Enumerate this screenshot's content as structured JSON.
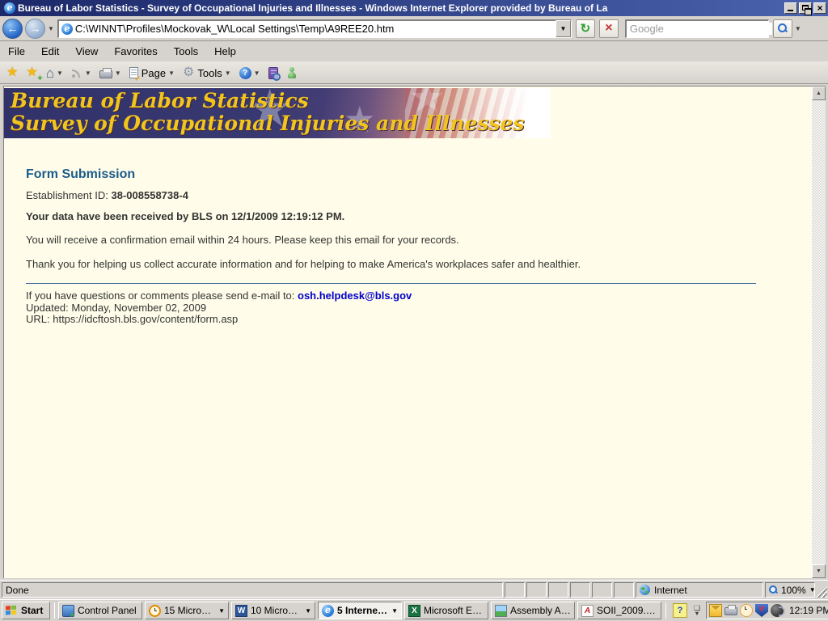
{
  "window": {
    "title": "Bureau of Labor Statistics - Survey of Occupational Injuries and Illnesses - Windows Internet Explorer provided by Bureau of La"
  },
  "address_bar": {
    "url": "C:\\WINNT\\Profiles\\Mockovak_W\\Local Settings\\Temp\\A9REE20.htm",
    "search_placeholder": "Google"
  },
  "menu_bar": {
    "items": [
      "File",
      "Edit",
      "View",
      "Favorites",
      "Tools",
      "Help"
    ]
  },
  "toolbar": {
    "page_label": "Page",
    "tools_label": "Tools"
  },
  "banner": {
    "line1": "Bureau of Labor Statistics",
    "line2": "Survey of Occupational Injuries and Illnesses"
  },
  "content": {
    "heading": "Form Submission",
    "establishment_label": "Establishment ID: ",
    "establishment_id": "38-008558738-4",
    "received_line": "Your data have been received by BLS on 12/1/2009 12:19:12 PM.",
    "para1": "You will receive a confirmation email within 24 hours. Please keep this email for your records.",
    "para2": "Thank you for helping us collect accurate information and for helping to make America's workplaces safer and healthier.",
    "contact_prefix": "If you have questions or comments please send e-mail to: ",
    "contact_email": "osh.helpdesk@bls.gov",
    "updated_line": "Updated: Monday, November 02, 2009",
    "url_line": "URL: https://idcftosh.bls.gov/content/form.asp"
  },
  "status_bar": {
    "status_text": "Done",
    "zone_label": "Internet",
    "zoom_level": "100%"
  },
  "taskbar": {
    "start_label": "Start",
    "buttons": [
      {
        "label": "Control Panel"
      },
      {
        "label": "15 Microso..."
      },
      {
        "label": "10 Microso..."
      },
      {
        "label": "5 Internet..."
      },
      {
        "label": "Microsoft Ex..."
      },
      {
        "label": "Assembly Ar..."
      },
      {
        "label": "SOII_2009.p..."
      }
    ],
    "clock": "12:19 PM"
  },
  "colors": {
    "banner_navy": "#38386e",
    "banner_gold": "#f2c51d",
    "heading_blue": "#1b5c8c",
    "link_blue": "#0000cc",
    "page_background": "#fffde9",
    "title_gradient_start": "#1c2868",
    "title_gradient_end": "#4a63ae"
  }
}
